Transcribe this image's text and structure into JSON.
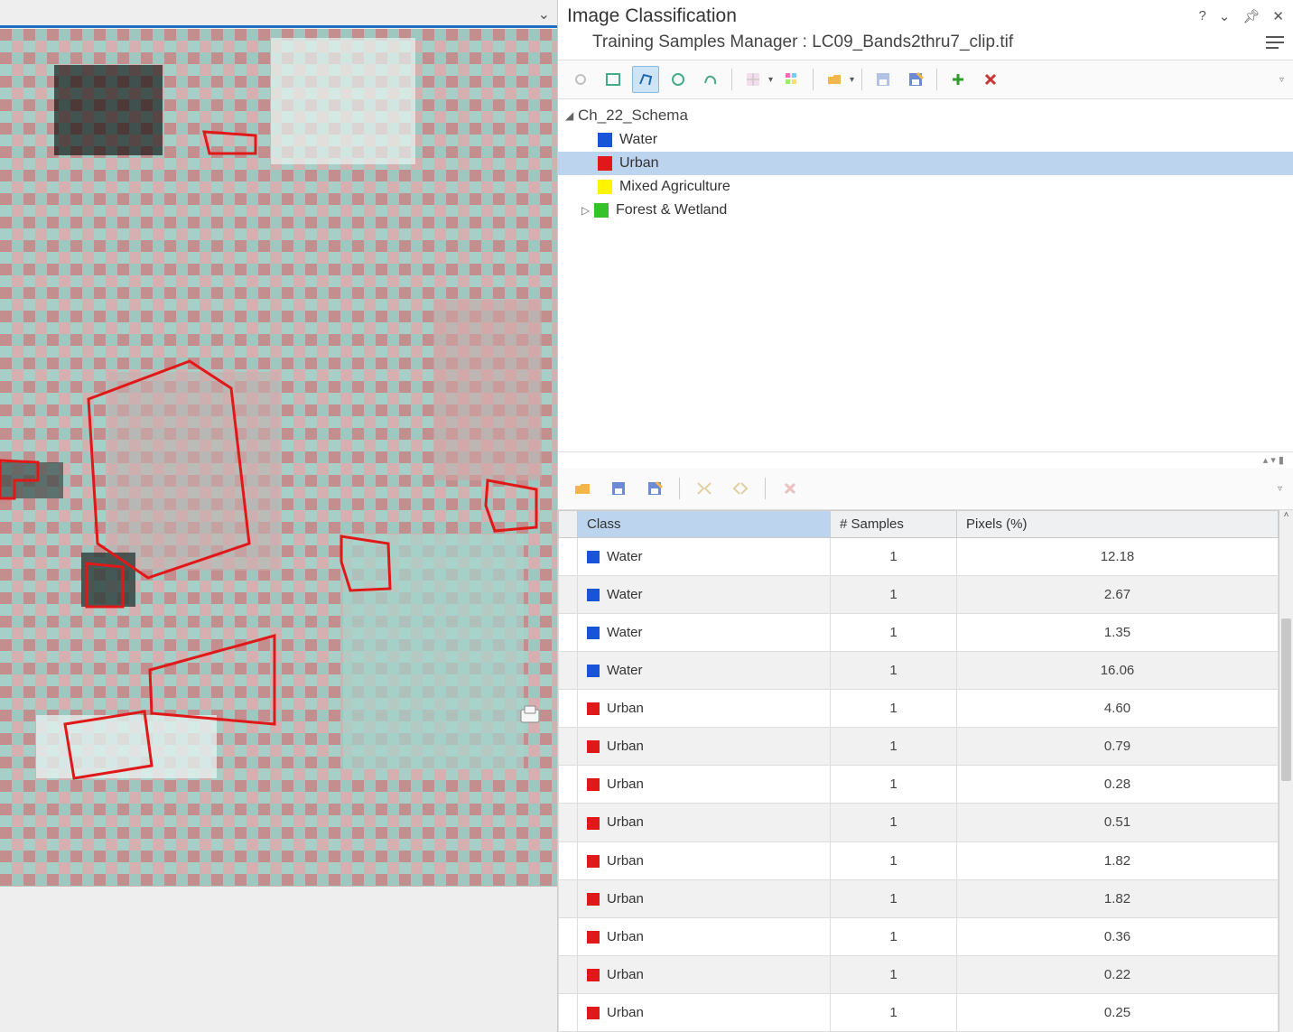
{
  "panel": {
    "title": "Image Classification",
    "subtitle": "Training Samples Manager : LC09_Bands2thru7_clip.tif"
  },
  "schema": {
    "name": "Ch_22_Schema",
    "classes": [
      {
        "label": "Water",
        "color": "#1854d8",
        "selected": false,
        "expandable": false
      },
      {
        "label": "Urban",
        "color": "#e01818",
        "selected": true,
        "expandable": false
      },
      {
        "label": "Mixed Agriculture",
        "color": "#fef400",
        "selected": false,
        "expandable": false
      },
      {
        "label": "Forest & Wetland",
        "color": "#35c22b",
        "selected": false,
        "expandable": true
      }
    ]
  },
  "tableHeaders": {
    "class": "Class",
    "samples": "# Samples",
    "pixels": "Pixels (%)"
  },
  "samples": [
    {
      "class": "Water",
      "color": "#1854d8",
      "count": 1,
      "pct": "12.18"
    },
    {
      "class": "Water",
      "color": "#1854d8",
      "count": 1,
      "pct": "2.67"
    },
    {
      "class": "Water",
      "color": "#1854d8",
      "count": 1,
      "pct": "1.35"
    },
    {
      "class": "Water",
      "color": "#1854d8",
      "count": 1,
      "pct": "16.06"
    },
    {
      "class": "Urban",
      "color": "#e01818",
      "count": 1,
      "pct": "4.60"
    },
    {
      "class": "Urban",
      "color": "#e01818",
      "count": 1,
      "pct": "0.79"
    },
    {
      "class": "Urban",
      "color": "#e01818",
      "count": 1,
      "pct": "0.28"
    },
    {
      "class": "Urban",
      "color": "#e01818",
      "count": 1,
      "pct": "0.51"
    },
    {
      "class": "Urban",
      "color": "#e01818",
      "count": 1,
      "pct": "1.82"
    },
    {
      "class": "Urban",
      "color": "#e01818",
      "count": 1,
      "pct": "1.82"
    },
    {
      "class": "Urban",
      "color": "#e01818",
      "count": 1,
      "pct": "0.36"
    },
    {
      "class": "Urban",
      "color": "#e01818",
      "count": 1,
      "pct": "0.22"
    },
    {
      "class": "Urban",
      "color": "#e01818",
      "count": 1,
      "pct": "0.25"
    }
  ],
  "colors": {
    "blue": "#1854d8",
    "red": "#e01818",
    "yellow": "#fef400",
    "green": "#35c22b"
  }
}
